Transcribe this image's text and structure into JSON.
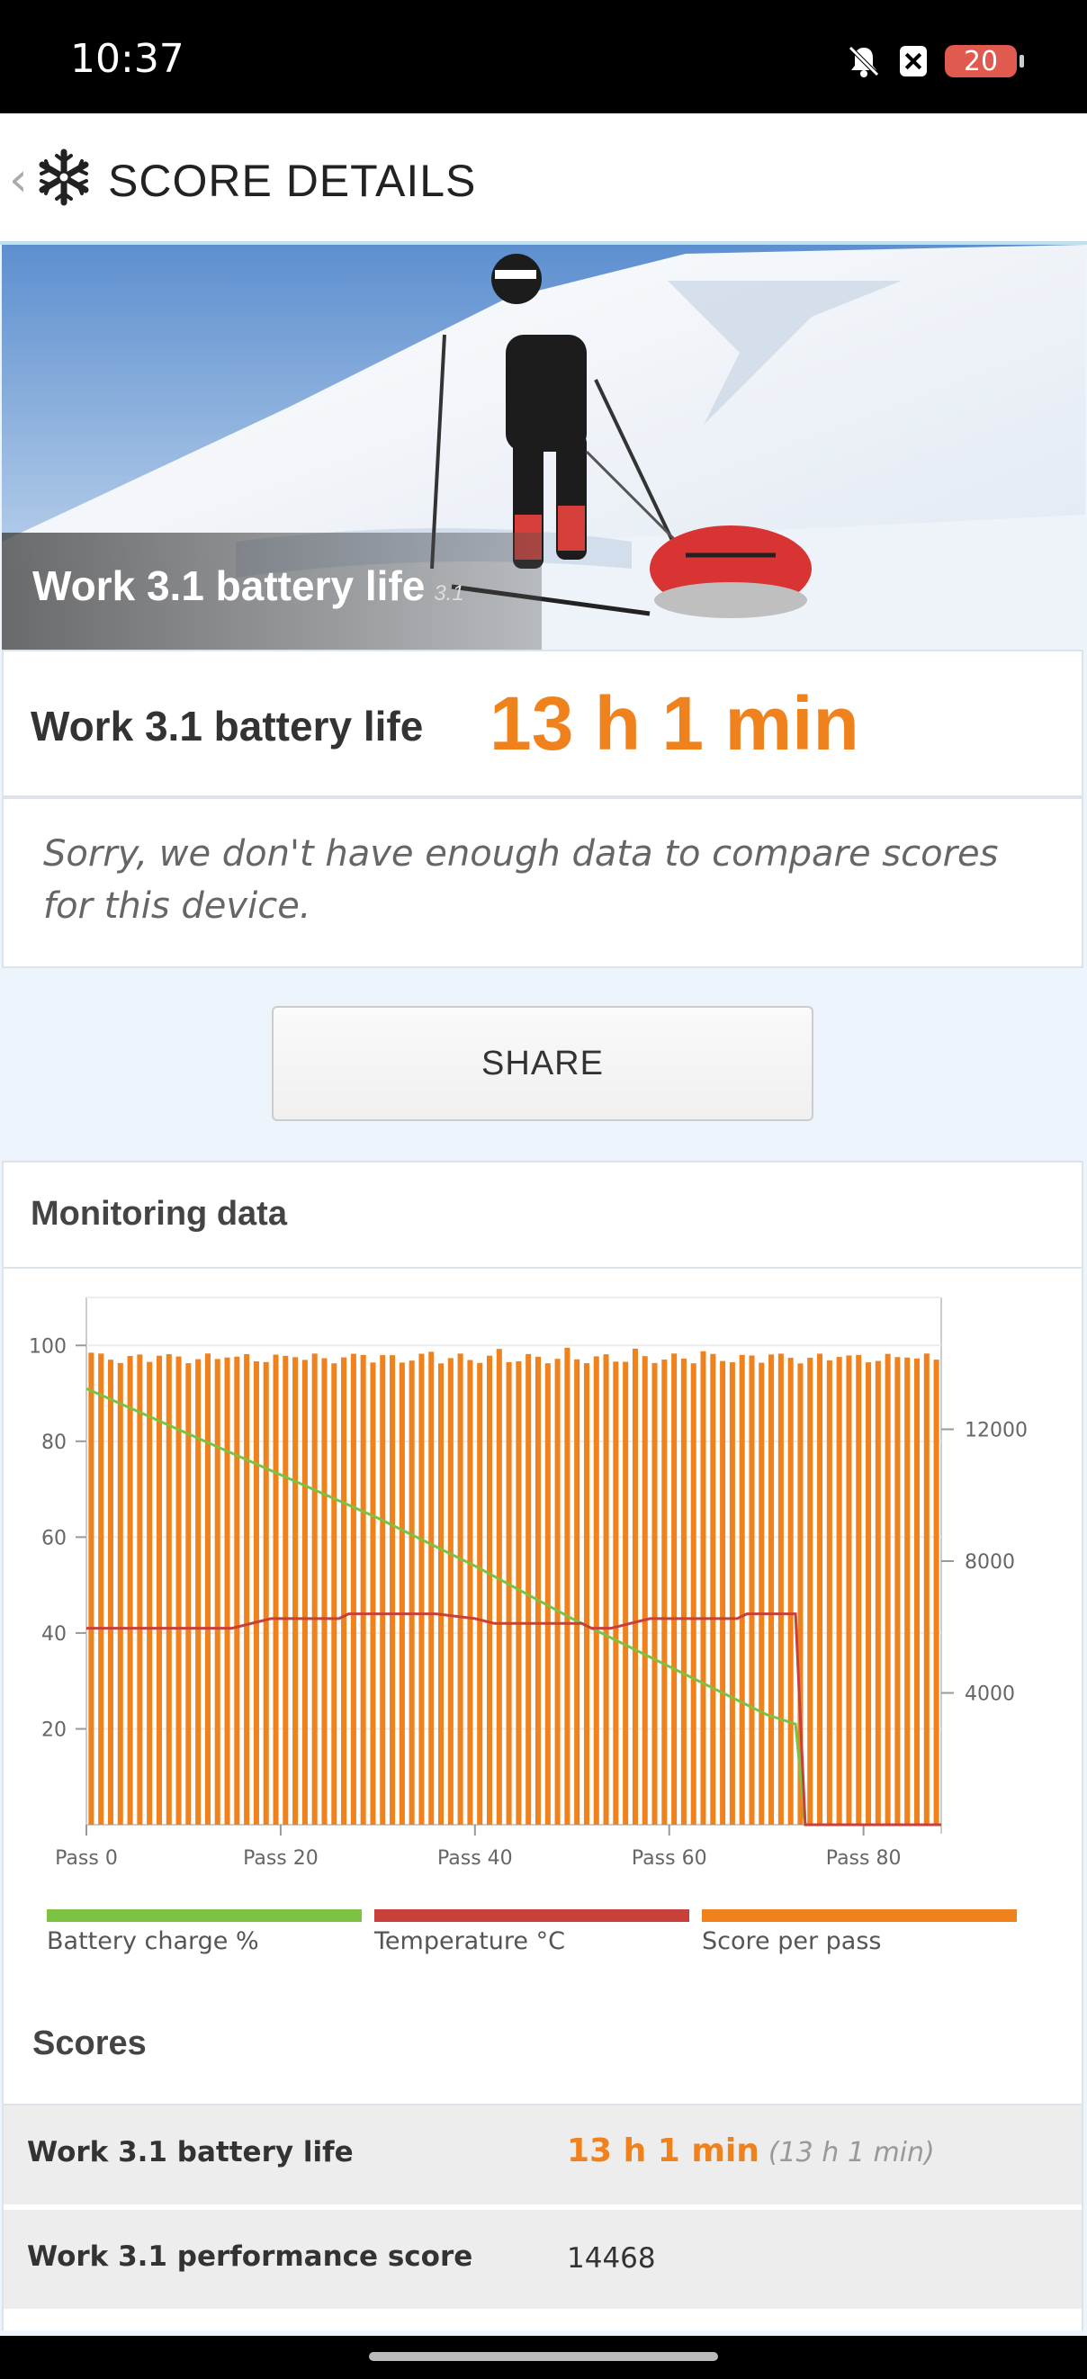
{
  "status_bar": {
    "time": "10:37",
    "battery": "20"
  },
  "header": {
    "title": "SCORE DETAILS"
  },
  "hero": {
    "title": "Work 3.1 battery life",
    "version": "3.1"
  },
  "score": {
    "label": "Work 3.1 battery life",
    "value": "13 h 1 min"
  },
  "notice": "Sorry, we don't have enough data to compare scores for this device.",
  "share_label": "SHARE",
  "monitoring": {
    "title": "Monitoring data"
  },
  "chart_data": {
    "type": "bar",
    "xlabel": "",
    "ylabel": "",
    "x_ticks": [
      "Pass 0",
      "Pass 20",
      "Pass 40",
      "Pass 60",
      "Pass 80"
    ],
    "x_range": [
      0,
      88
    ],
    "left_axis": {
      "ticks": [
        20,
        40,
        60,
        80,
        100
      ],
      "range": [
        0,
        110
      ]
    },
    "right_axis": {
      "ticks": [
        4000,
        8000,
        12000
      ],
      "range": [
        0,
        16000
      ]
    },
    "grid": true,
    "legend_position": "bottom",
    "series": [
      {
        "name": "Battery charge %",
        "type": "line",
        "axis": "left",
        "color": "#7dc242",
        "points": [
          [
            0,
            91
          ],
          [
            10,
            82
          ],
          [
            20,
            73
          ],
          [
            30,
            64
          ],
          [
            40,
            54
          ],
          [
            50,
            43
          ],
          [
            60,
            33
          ],
          [
            70,
            23
          ],
          [
            73,
            21
          ],
          [
            74,
            0
          ]
        ]
      },
      {
        "name": "Temperature °C",
        "type": "line",
        "axis": "left",
        "color": "#c8403a",
        "points": [
          [
            0,
            41
          ],
          [
            15,
            41
          ],
          [
            19,
            43
          ],
          [
            26,
            43
          ],
          [
            27,
            44
          ],
          [
            36,
            44
          ],
          [
            40,
            43
          ],
          [
            42,
            42
          ],
          [
            51,
            42
          ],
          [
            52,
            41
          ],
          [
            54,
            41
          ],
          [
            58,
            43
          ],
          [
            67,
            43
          ],
          [
            68,
            44
          ],
          [
            73,
            44
          ],
          [
            74,
            0
          ],
          [
            88,
            0
          ]
        ]
      },
      {
        "name": "Score per pass",
        "type": "bar",
        "axis": "right",
        "color": "#f0821e",
        "approx_value_range": [
          14000,
          14500
        ],
        "passes": 88
      }
    ]
  },
  "legend": [
    {
      "label": "Battery charge %",
      "color": "#7dc242"
    },
    {
      "label": "Temperature °C",
      "color": "#c8403a"
    },
    {
      "label": "Score per pass",
      "color": "#f0821e"
    }
  ],
  "scores": {
    "title": "Scores",
    "rows": [
      {
        "label": "Work 3.1 battery life",
        "value": "13 h 1 min",
        "sub": "(13 h 1 min)"
      },
      {
        "label": "Work 3.1 performance score",
        "value": "14468"
      }
    ]
  }
}
